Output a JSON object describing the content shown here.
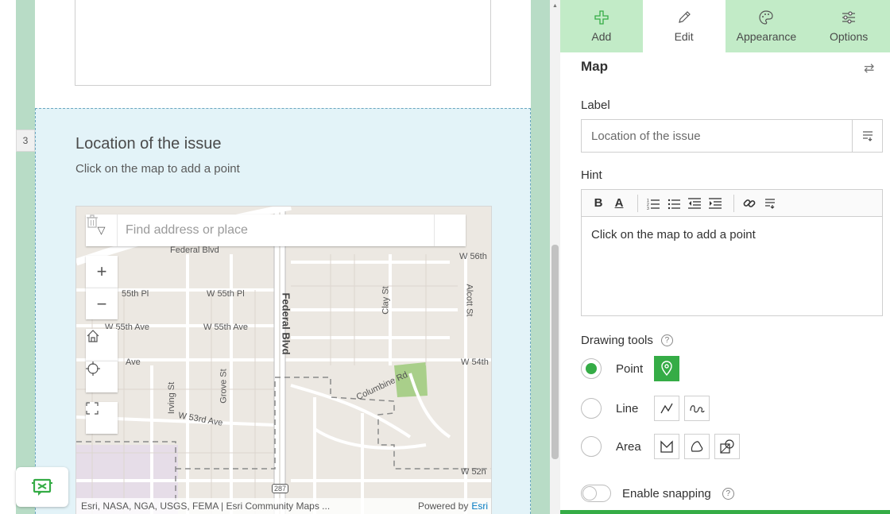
{
  "canvas": {
    "question_number": "3",
    "question_title": "Location of the issue",
    "question_hint": "Click on the map to add a point"
  },
  "map": {
    "search_placeholder": "Find address or place",
    "labels": {
      "federal_blvd_top": "Federal Blvd",
      "w56th": "W 56th",
      "e55th_pl": "55th Pl",
      "w55th_pl": "W 55th Pl",
      "federal_blvd": "Federal Blvd",
      "clay_st": "Clay St",
      "alcott_st": "Alcott St",
      "w55th_ave_left": "W 55th Ave",
      "w55th_ave": "W 55th Ave",
      "ave": "Ave",
      "w54th": "W 54th",
      "columbine_rd": "Columbine Rd",
      "irving_st": "Irving St",
      "grove_st": "Grove St",
      "w53rd_ave": "W 53rd Ave",
      "w52n": "W 52n",
      "route": "287"
    },
    "attribution": "Esri, NASA, NGA, USGS, FEMA | Esri Community Maps ...",
    "powered_by": "Powered by",
    "powered_by_link": "Esri"
  },
  "panel": {
    "tabs": [
      {
        "label": "Add",
        "icon": "plus-icon"
      },
      {
        "label": "Edit",
        "icon": "pencil-icon"
      },
      {
        "label": "Appearance",
        "icon": "palette-icon"
      },
      {
        "label": "Options",
        "icon": "sliders-icon"
      }
    ],
    "title": "Map",
    "label_heading": "Label",
    "label_placeholder": "Location of the issue",
    "hint_heading": "Hint",
    "hint_toolbar": {
      "bold": "B",
      "color": "A"
    },
    "hint_text": "Click on the map to add a point",
    "drawing_heading": "Drawing tools",
    "tools": [
      {
        "label": "Point",
        "selected": true
      },
      {
        "label": "Line",
        "selected": false
      },
      {
        "label": "Area",
        "selected": false
      }
    ],
    "snapping_label": "Enable snapping"
  },
  "colors": {
    "accent_green": "#35ac46",
    "tab_green": "#c2ebc7",
    "side_bar_green": "#b8dcc6",
    "question_bg": "#e3f3f8"
  }
}
